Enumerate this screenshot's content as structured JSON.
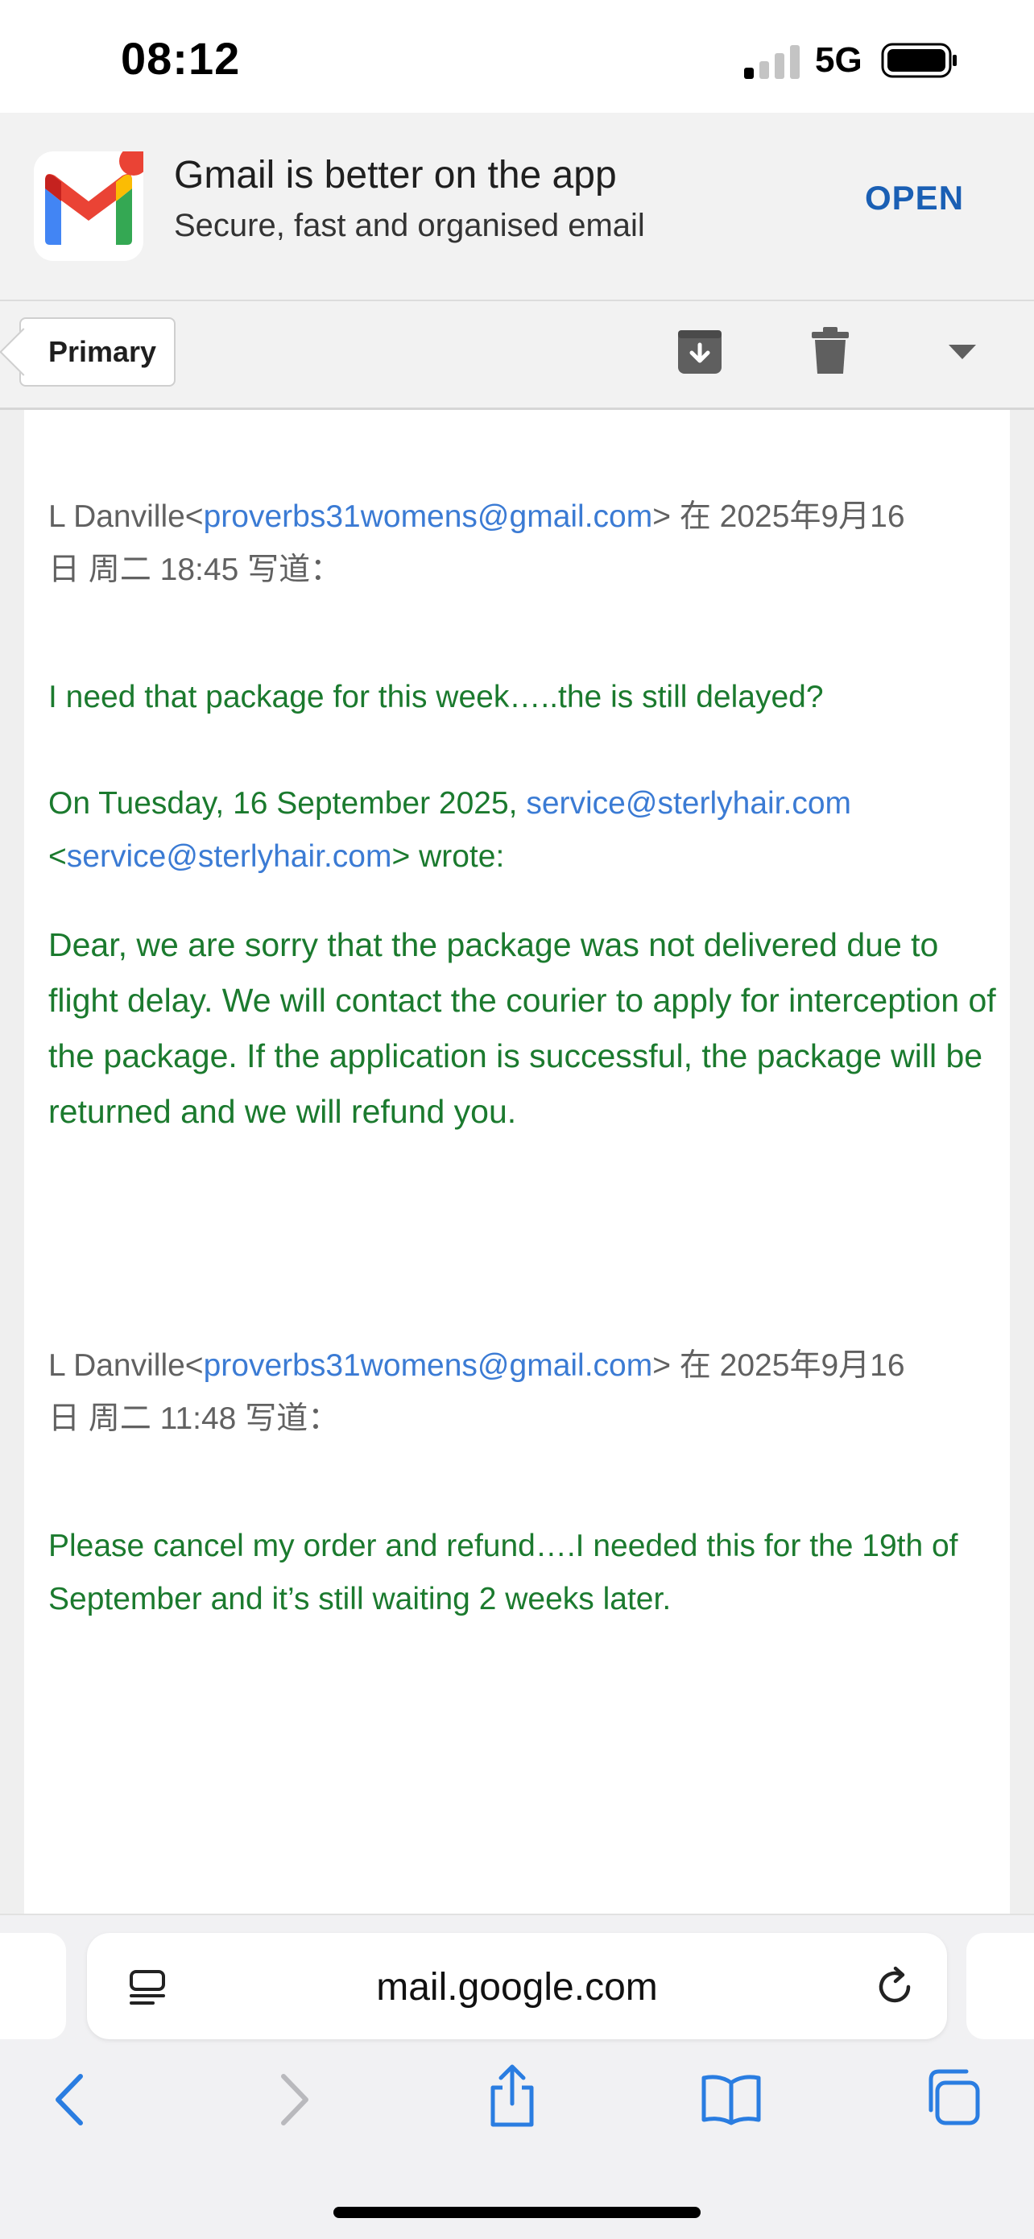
{
  "status": {
    "time": "08:12",
    "network": "5G"
  },
  "banner": {
    "title": "Gmail is better on the app",
    "subtitle": "Secure, fast and organised email",
    "open_label": "OPEN"
  },
  "toolbar": {
    "back_label": "Primary"
  },
  "thread": {
    "q1_name": "L Danville<",
    "q1_email": "proverbs31womens@gmail.com",
    "q1_rest": "> 在 2025年9月16",
    "q1_line2": "日 周二 18:45 写道：",
    "reply1": "I need that package for this week…..the is still delayed?",
    "q2_pre": "On Tuesday, 16 September 2025, ",
    "q2_email": "service@sterlyhair.com",
    "q2_lt": "<",
    "q2_email2": "service@sterlyhair.com",
    "q2_post": "> wrote:",
    "service_reply": "Dear, we are sorry that the package was not delivered due to flight delay. We will contact the courier to apply for interception of the package. If the application is successful, the package will be returned and we will refund you.",
    "q3_name": "L Danville<",
    "q3_email": "proverbs31womens@gmail.com",
    "q3_rest": "> 在 2025年9月16",
    "q3_line2": "日 周二 11:48 写道：",
    "original": "Please cancel my order and  refund….I needed this for the 19th of September and it’s still waiting 2 weeks later."
  },
  "browser": {
    "url": "mail.google.com"
  },
  "icons": {
    "archive": "archive-icon",
    "delete": "trash-icon",
    "more": "chevron-down-icon",
    "reader": "reader-mode-icon",
    "reload": "reload-icon",
    "back": "back-arrow-icon",
    "forward": "forward-arrow-icon",
    "share": "share-icon",
    "bookmarks": "bookmarks-icon",
    "tabs": "tabs-icon"
  },
  "colors": {
    "quoted_text": "#1b7a2e",
    "link": "#3b7bd4",
    "open_button": "#1a5fb4",
    "safari_icons": "#2a7de1"
  }
}
